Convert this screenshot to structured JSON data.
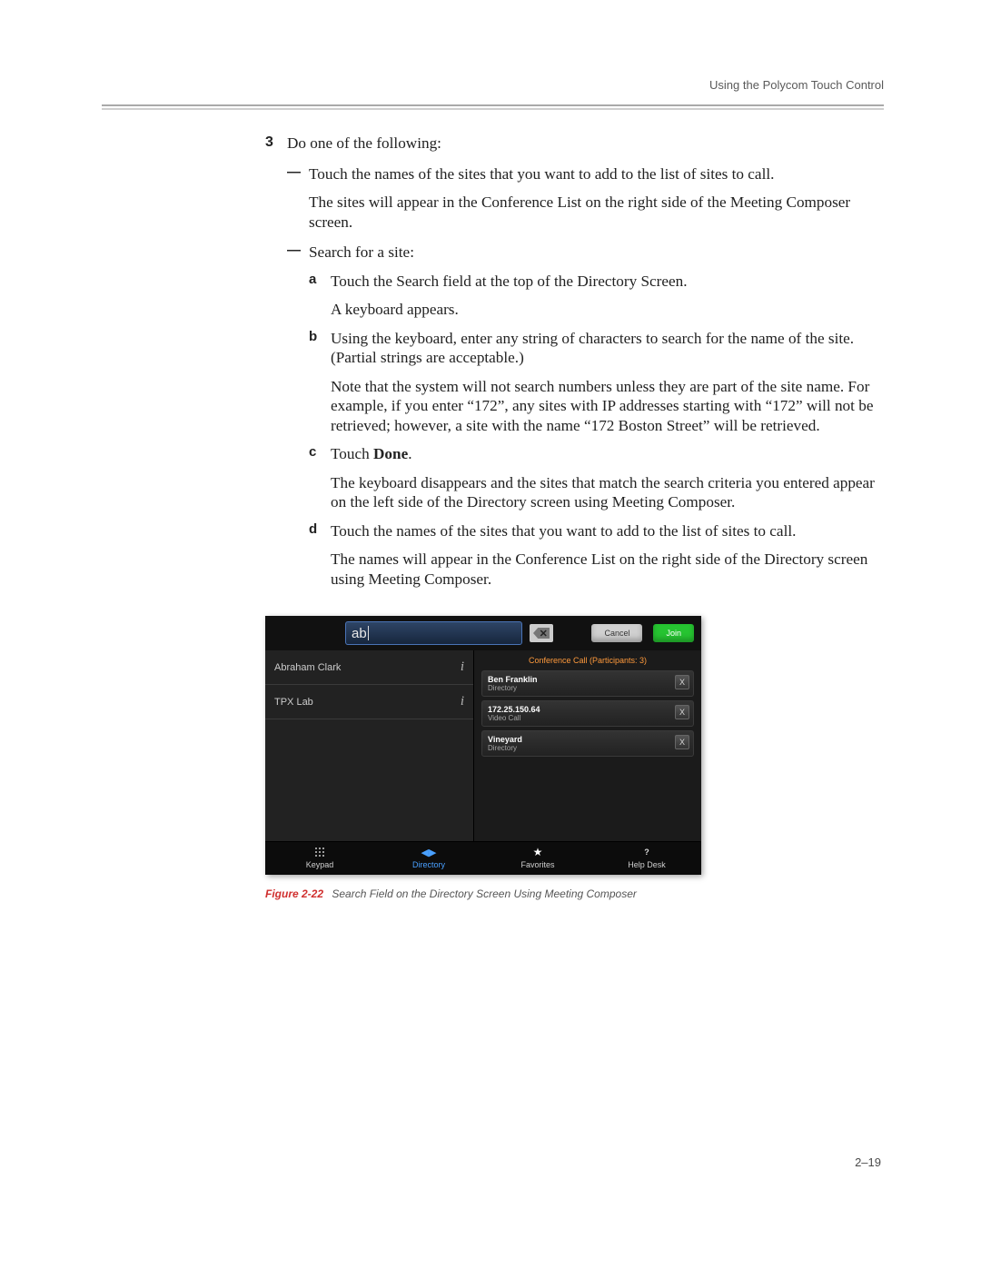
{
  "header": {
    "title": "Using the Polycom Touch Control"
  },
  "step": {
    "number": "3",
    "intro": "Do one of the following:",
    "dash_mark": "—",
    "items": [
      {
        "lead": "Touch the names of the sites that you want to add to the list of sites to call.",
        "para1": "The sites will appear in the Conference List on the right side of the Meeting Composer screen."
      },
      {
        "lead": "Search for a site:",
        "alpha": [
          {
            "letter": "a",
            "p1": "Touch the Search field at the top of the Directory Screen.",
            "p2": "A keyboard appears."
          },
          {
            "letter": "b",
            "p1": "Using the keyboard, enter any string of characters to search for the name of the site. (Partial strings are acceptable.)",
            "p2": "Note that the system will not search numbers unless they are part of the site name. For example, if you enter “172”, any sites with IP addresses starting with “172” will not be retrieved; however, a site with the name “172 Boston Street” will be retrieved."
          },
          {
            "letter": "c",
            "p1_prefix": "Touch ",
            "p1_bold": "Done",
            "p1_suffix": ".",
            "p2": "The keyboard disappears and the sites that match the search criteria you entered appear on the left side of the Directory screen using Meeting Composer."
          },
          {
            "letter": "d",
            "p1": "Touch the names of the sites that you want to add to the list of sites to call.",
            "p2": "The names will appear in the Conference List on the right side of the Directory screen using Meeting Composer."
          }
        ]
      }
    ]
  },
  "figure": {
    "number": "Figure 2-22",
    "caption": "Search Field on the Directory Screen Using Meeting Composer",
    "ui": {
      "search_value": "ab",
      "backspace_glyph": "⌫",
      "cancel_label": "Cancel",
      "join_label": "Join",
      "results": [
        {
          "name": "Abraham Clark"
        },
        {
          "name": "TPX Lab"
        }
      ],
      "info_glyph": "i",
      "conf_header": "Conference Call (Participants: 3)",
      "participants": [
        {
          "name": "Ben Franklin",
          "sub": "Directory"
        },
        {
          "name": "172.25.150.64",
          "sub": "Video Call"
        },
        {
          "name": "Vineyard",
          "sub": "Directory"
        }
      ],
      "remove_glyph": "X",
      "tabs": {
        "keypad": "Keypad",
        "directory": "Directory",
        "favorites": "Favorites",
        "helpdesk": "Help Desk",
        "dir_icon_glyph": "◀▶",
        "star_glyph": "★",
        "q_glyph": "?"
      }
    }
  },
  "page_number": "2–19"
}
